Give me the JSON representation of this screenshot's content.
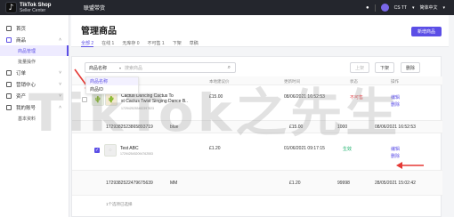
{
  "header": {
    "brand_line1": "TikTok Shop",
    "brand_line2": "Seller Center",
    "nav_label": "联盟带货",
    "account": "CS TT",
    "language": "简体中文"
  },
  "sidebar": {
    "items": [
      {
        "label": "首页"
      },
      {
        "label": "商品"
      },
      {
        "label": "订单"
      },
      {
        "label": "营销中心"
      },
      {
        "label": "资产"
      },
      {
        "label": "我的账号"
      }
    ],
    "product_subs": [
      "商品管理",
      "批量操作"
    ],
    "account_subs": [
      "基本资料"
    ]
  },
  "page": {
    "title": "管理商品",
    "new_button": "新增商品",
    "tabs": [
      "全部 2",
      "在线 1",
      "无库存 0",
      "不可售 1",
      "下架",
      "草稿"
    ]
  },
  "toolbar": {
    "select_value": "商品名称",
    "search_placeholder": "搜索商品",
    "btn_online": "上架",
    "btn_offline": "下架",
    "btn_delete": "删除"
  },
  "dropdown": {
    "options": [
      "商品名称",
      "商品ID"
    ]
  },
  "table": {
    "headers": [
      "商品名称",
      "本地建议价",
      "更新时间",
      "状态",
      "操作"
    ],
    "rows": [
      {
        "name_line1": "Cactus Dancing Cactus To",
        "name_line2": "st Cactus Twist Singing Dance B..",
        "product_id": "1729425253482397823",
        "price": "£15.00",
        "updated": "08/06/2021 16:52:53",
        "status": "不可售",
        "action1": "编辑",
        "action2": "删除"
      },
      {
        "sku_id": "1729382523865893719",
        "variant": "blue",
        "price": "£15.00",
        "stock": "1000",
        "updated": "08/06/2021 16:52:53"
      },
      {
        "name_line1": "Test ABC",
        "product_id": "1729425452094762553",
        "price": "£1.20",
        "updated": "01/06/2021 09:17:15",
        "status": "生效",
        "action1": "编辑",
        "action2": "删除"
      },
      {
        "sku_id": "1729382522479675639",
        "variant": "MM",
        "price": "£1.20",
        "stock": "99998",
        "updated": "28/05/2021 15:02:42"
      }
    ],
    "footer_hint": "1个选项已选择"
  },
  "watermark": "TikTok之先生",
  "colors": {
    "accent": "#5b4ee6",
    "topbar": "#24262d",
    "arrow": "#e53935"
  }
}
